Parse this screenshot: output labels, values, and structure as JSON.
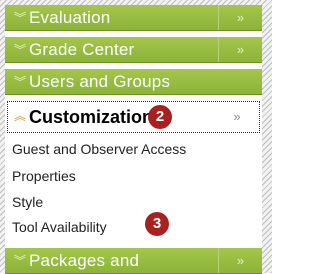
{
  "menu": {
    "collapsed_top": [
      {
        "label": "Evaluation",
        "chevron": "chevron-down-double-icon",
        "expand": "»"
      },
      {
        "label": "Grade Center",
        "chevron": "chevron-down-double-icon",
        "expand": "»"
      },
      {
        "label": "Users and Groups",
        "chevron": "chevron-down-double-icon",
        "expand": "»"
      }
    ],
    "open_section": {
      "label": "Customization",
      "badge": "2",
      "expand": "»",
      "chevron": "chevron-up-double-icon"
    },
    "sub_items": [
      {
        "label": "Guest and Observer Access"
      },
      {
        "label": "Properties"
      },
      {
        "label": "Style"
      },
      {
        "label": "Tool Availability",
        "badge": "3"
      }
    ],
    "collapsed_bottom": [
      {
        "label": "Packages and",
        "chevron": "chevron-down-double-icon",
        "expand": "»"
      }
    ]
  },
  "colors": {
    "bar_green": "#9cc045",
    "badge_red": "#a82020",
    "chevron_orange": "#e0902a"
  }
}
